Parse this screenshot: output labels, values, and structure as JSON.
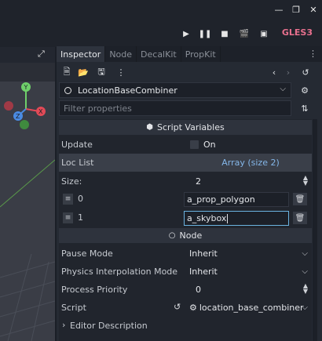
{
  "window": {
    "minimize_icon": "minimize-icon",
    "restore_icon": "restore-icon",
    "close_icon": "close-icon"
  },
  "toolbar": {
    "renderer_label": "GLES3",
    "play_icon": "play-icon",
    "pause_icon": "pause-icon",
    "stop_icon": "stop-icon",
    "play_scene_icon": "play-scene-icon",
    "play_custom_icon": "play-custom-icon",
    "movie_icon": "movie-icon"
  },
  "dock": {
    "tabs": [
      "Inspector",
      "Node",
      "DecalKit",
      "PropKit"
    ],
    "active_tab": "Inspector"
  },
  "inspector": {
    "object_name": "LocationBaseCombiner",
    "filter_placeholder": "Filter properties",
    "sections": {
      "script_variables": "Script Variables",
      "node": "Node"
    },
    "properties": {
      "update_label": "Update",
      "update_value": "On",
      "loc_list_label": "Loc List",
      "loc_list_value": "Array (size 2)",
      "size_label": "Size:",
      "size_value": "2",
      "items": [
        {
          "index": "0",
          "value": "a_prop_polygon"
        },
        {
          "index": "1",
          "value": "a_skybox"
        }
      ],
      "pause_mode_label": "Pause Mode",
      "pause_mode_value": "Inherit",
      "physics_interp_label": "Physics Interpolation Mode",
      "physics_interp_value": "Inherit",
      "process_priority_label": "Process Priority",
      "process_priority_value": "0",
      "script_label": "Script",
      "script_value": "location_base_combiner",
      "editor_description_label": "Editor Description"
    }
  }
}
